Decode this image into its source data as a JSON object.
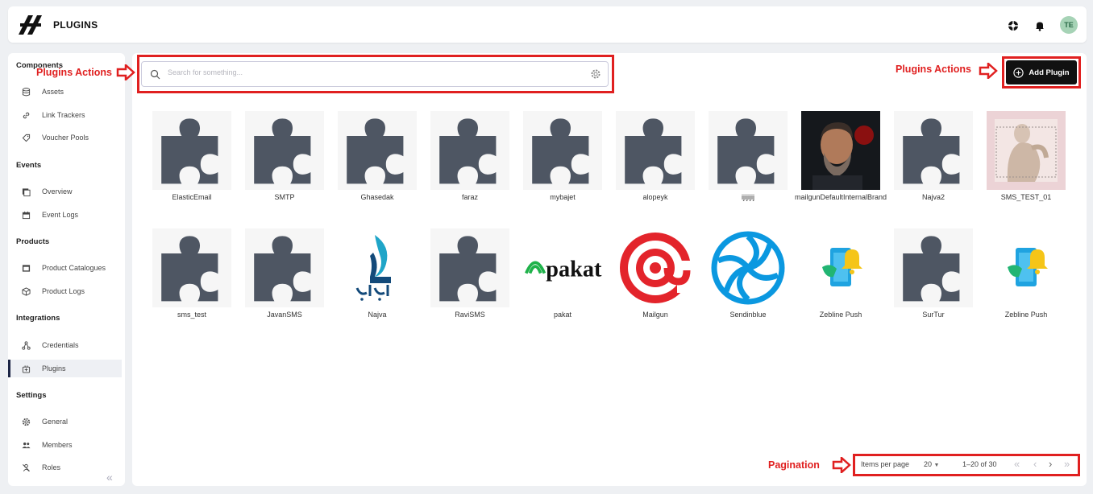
{
  "header": {
    "title": "PLUGINS",
    "avatar": "TE"
  },
  "sidebar": {
    "sections": [
      {
        "title": "Components",
        "items": [
          {
            "label": "Assets"
          },
          {
            "label": "Link Trackers"
          },
          {
            "label": "Voucher Pools"
          }
        ]
      },
      {
        "title": "Events",
        "items": [
          {
            "label": "Overview"
          },
          {
            "label": "Event Logs"
          }
        ]
      },
      {
        "title": "Products",
        "items": [
          {
            "label": "Product Catalogues"
          },
          {
            "label": "Product Logs"
          }
        ]
      },
      {
        "title": "Integrations",
        "items": [
          {
            "label": "Credentials"
          },
          {
            "label": "Plugins",
            "active": true
          }
        ]
      },
      {
        "title": "Settings",
        "items": [
          {
            "label": "General"
          },
          {
            "label": "Members"
          },
          {
            "label": "Roles"
          }
        ]
      }
    ]
  },
  "search": {
    "placeholder": "Search for something...",
    "value": ""
  },
  "add_button": {
    "label": "Add Plugin"
  },
  "plugins": [
    {
      "name": "ElasticEmail",
      "icon": "puzzle-icon"
    },
    {
      "name": "SMTP",
      "icon": "puzzle-icon"
    },
    {
      "name": "Ghasedak",
      "icon": "puzzle-icon"
    },
    {
      "name": "faraz",
      "icon": "puzzle-icon"
    },
    {
      "name": "mybajet",
      "icon": "puzzle-icon"
    },
    {
      "name": "alopeyk",
      "icon": "puzzle-icon"
    },
    {
      "name": "ijijijij",
      "icon": "puzzle-icon"
    },
    {
      "name": "mailgunDefaultInternalBrand",
      "icon": "portrait-photo"
    },
    {
      "name": "Najva2",
      "icon": "puzzle-icon"
    },
    {
      "name": "SMS_TEST_01",
      "icon": "statue-photo"
    },
    {
      "name": "sms_test",
      "icon": "puzzle-icon"
    },
    {
      "name": "JavanSMS",
      "icon": "puzzle-icon"
    },
    {
      "name": "Najva",
      "icon": "najva-logo"
    },
    {
      "name": "RaviSMS",
      "icon": "puzzle-icon"
    },
    {
      "name": "pakat",
      "icon": "pakat-logo",
      "logo_text": "pakat"
    },
    {
      "name": "Mailgun",
      "icon": "mailgun-logo"
    },
    {
      "name": "Sendinblue",
      "icon": "sendinblue-logo"
    },
    {
      "name": "Zebline Push",
      "icon": "zebline-logo"
    },
    {
      "name": "SurTur",
      "icon": "puzzle-icon"
    },
    {
      "name": "Zebline Push",
      "icon": "zebline-logo"
    }
  ],
  "pagination": {
    "items_per_page_label": "Items per page",
    "items_per_page_value": "20",
    "range": "1–20 of 30"
  },
  "annotations": {
    "search": "Plugins Actions",
    "add": "Plugins Actions",
    "pagination": "Pagination"
  },
  "colors": {
    "annotation": "#e02020",
    "puzzle": "#4e5663",
    "primary_button": "#111111"
  }
}
